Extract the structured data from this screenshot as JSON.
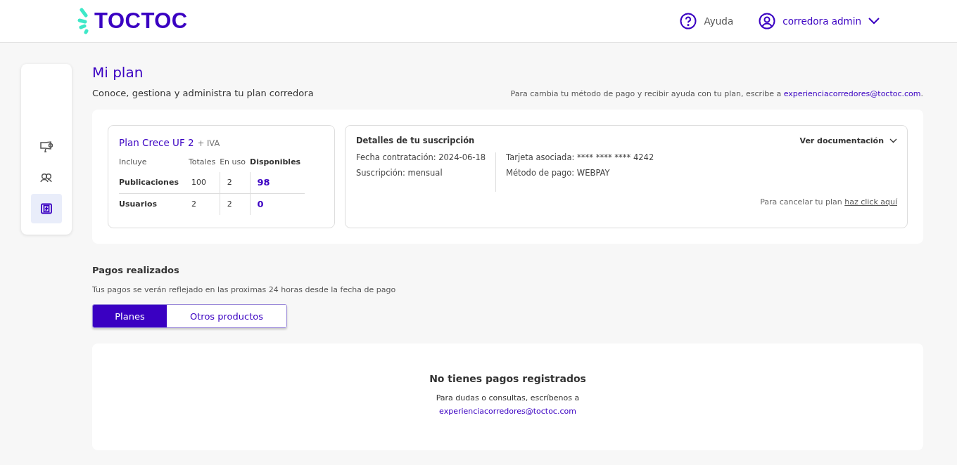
{
  "header": {
    "logo": "TOCTOC",
    "help": "Ayuda",
    "user": "corredora admin"
  },
  "sidebar": {
    "items": [
      {
        "kind": "megaphone",
        "selected": false
      },
      {
        "kind": "users",
        "selected": false
      },
      {
        "kind": "plan",
        "selected": true
      }
    ]
  },
  "page": {
    "title": "Mi plan",
    "subtitle": "Conoce, gestiona y administra tu plan corredora",
    "notice": {
      "text": "Para cambia tu método de pago y recibir ayuda con tu plan, escribe a ",
      "link": "experienciacorredores@toctoc.com",
      "end": "."
    }
  },
  "plan": {
    "name": "Plan Crece UF 2",
    "suffix": "+ IVA",
    "columns": [
      "Incluye",
      "Totales",
      "En uso",
      "Disponibles"
    ],
    "rows": [
      {
        "cells": [
          "Publicaciones",
          "100",
          "2",
          "98"
        ]
      },
      {
        "cells": [
          "Usuarios",
          "2",
          "2",
          "0"
        ]
      }
    ]
  },
  "subscription": {
    "title": "Detalles de tu suscripción",
    "docs": "Ver documentación",
    "left": [
      "Fecha contratación: 2024-06-18",
      "Suscripción: mensual"
    ],
    "right": [
      "Tarjeta asociada: **** **** **** 4242",
      "Método de pago: WEBPAY"
    ],
    "cancel": {
      "text": "Para cancelar tu plan ",
      "link": "haz click aquí"
    }
  },
  "payments": {
    "title": "Pagos realizados",
    "subtitle": "Tus pagos se verán reflejado en las proximas 24 horas desde la fecha de pago",
    "tabs": [
      {
        "label": "Planes",
        "selected": true
      },
      {
        "label": "Otros productos",
        "selected": false
      }
    ],
    "empty": {
      "title": "No tienes pagos registrados",
      "text": "Para dudas o consultas, escríbenos a",
      "link": "experienciacorredores@toctoc.com"
    }
  }
}
